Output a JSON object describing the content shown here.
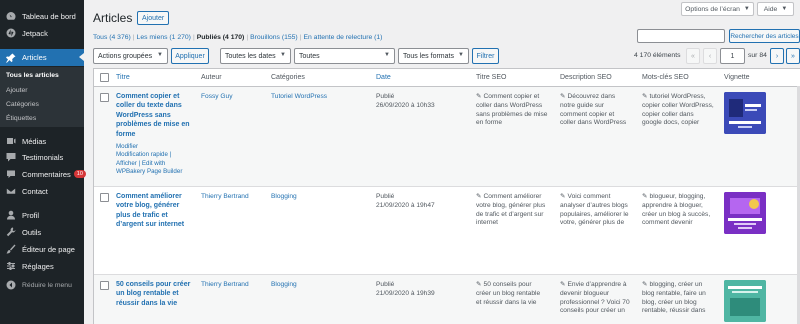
{
  "sidebar": {
    "dashboard": "Tableau de bord",
    "jetpack": "Jetpack",
    "articles": "Articles",
    "sub": [
      "Tous les articles",
      "Ajouter",
      "Catégories",
      "Étiquettes"
    ],
    "medias": "Médias",
    "testimonials": "Testimonials",
    "comments": "Commentaires",
    "comments_badge": "10",
    "contact": "Contact",
    "profile": "Profil",
    "tools": "Outils",
    "page_editor": "Éditeur de page",
    "settings": "Réglages",
    "collapse": "Réduire le menu"
  },
  "header": {
    "screen_options": "Options de l’écran",
    "help": "Aide",
    "title": "Articles",
    "add_new": "Ajouter"
  },
  "views": {
    "all": "Tous (4 376)",
    "mine": "Les miens (1 270)",
    "published": "Publiés (4 170)",
    "drafts": "Brouillons (155)",
    "pending": "En attente de relecture (1)"
  },
  "search": {
    "button": "Rechercher des articles",
    "value": ""
  },
  "filters": {
    "bulk": "Actions groupées",
    "apply": "Appliquer",
    "dates": "Toutes les dates",
    "categories": "Toutes",
    "formats": "Tous les formats",
    "filter": "Filtrer"
  },
  "pagination": {
    "count": "4 170 éléments",
    "first": "«",
    "prev": "‹",
    "current": "1",
    "of": "sur 84",
    "next": "›",
    "last": "»"
  },
  "columns": {
    "title": "Titre",
    "author": "Auteur",
    "categories": "Catégories",
    "date": "Date",
    "seo_title": "Titre SEO",
    "seo_desc": "Description SEO",
    "seo_keywords": "Mots-clés SEO",
    "thumb": "Vignette"
  },
  "rows": [
    {
      "title_lines": [
        "Comment copier et",
        "coller du texte dans",
        "WordPress sans",
        "problèmes de mise en",
        "forme"
      ],
      "actions": [
        "Modifier",
        "Modification rapide |",
        "Afficher | Edit with",
        "WPBakery Page Builder"
      ],
      "author": "Fossy Guy",
      "category": "Tutoriel WordPress",
      "status": "Publié",
      "date": "26/09/2020 à 10h33",
      "seo_title": [
        "Comment copier et",
        "coller dans WordPress",
        "sans problèmes de mise",
        "en forme"
      ],
      "seo_desc": [
        "Découvrez dans",
        "notre guide sur",
        "comment copier et",
        "coller dans WordPress"
      ],
      "seo_keywords": [
        "tutoriel WordPress,",
        "copier coller WordPress,",
        "copier coller dans",
        "google docs, copier"
      ],
      "thumb_color": "#3b4ab8"
    },
    {
      "title_lines": [
        "Comment améliorer",
        "votre blog, générer",
        "plus de trafic et",
        "d’argent sur internet"
      ],
      "actions": [],
      "author": "Thierry Bertrand",
      "category": "Blogging",
      "status": "Publié",
      "date": "21/09/2020 à 19h47",
      "seo_title": [
        "Comment améliorer",
        "votre blog, générer plus",
        "de trafic et d’argent sur",
        "internet"
      ],
      "seo_desc": [
        "Voici comment",
        "analyser d’autres blogs",
        "populaires, améliorer le",
        "votre, générer plus de"
      ],
      "seo_keywords": [
        "blogueur, blogging,",
        "apprendre à bloguer,",
        "créer un blog à succès,",
        "comment devenir"
      ],
      "thumb_color": "#7a2fc4"
    },
    {
      "title_lines": [
        "50 conseils pour créer",
        "un blog rentable et",
        "réussir dans la vie"
      ],
      "actions": [],
      "author": "Thierry Bertrand",
      "category": "Blogging",
      "status": "Publié",
      "date": "21/09/2020 à 19h39",
      "seo_title": [
        "50 conseils pour",
        "créer un blog rentable",
        "et réussir dans la vie"
      ],
      "seo_desc": [
        "Envie d’apprendre à",
        "devenir blogueur",
        "professionnel ? Voici 70",
        "conseils pour créer un"
      ],
      "seo_keywords": [
        "blogging, créer un",
        "blog rentable, faire un",
        "blog, créer un blog",
        "rentable, réussir dans"
      ],
      "thumb_color": "#4fb6a3"
    }
  ]
}
